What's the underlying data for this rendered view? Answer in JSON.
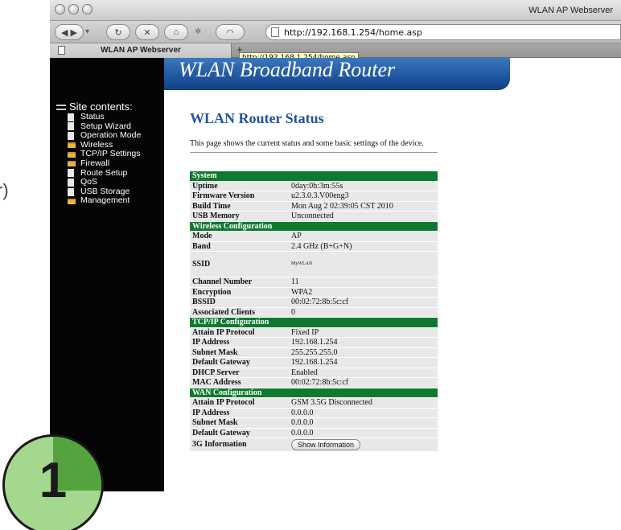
{
  "window": {
    "title": "WLAN AP Webserver"
  },
  "toolbar": {
    "url": "http://192.168.1.254/home.asp"
  },
  "tab": {
    "label": "WLAN AP Webserver",
    "add": "+"
  },
  "tooltip": "http://192.168.1.254/home.asp",
  "banner": {
    "title": "WLAN Broadband Router"
  },
  "sidebar": {
    "heading": "Site contents:",
    "items": [
      {
        "label": "Status",
        "icon": "document-icon"
      },
      {
        "label": "Setup Wizard",
        "icon": "document-icon"
      },
      {
        "label": "Operation Mode",
        "icon": "document-icon"
      },
      {
        "label": "Wireless",
        "icon": "folder-icon"
      },
      {
        "label": "TCP/IP Settings",
        "icon": "folder-icon"
      },
      {
        "label": "Firewall",
        "icon": "folder-icon"
      },
      {
        "label": "Route Setup",
        "icon": "document-icon"
      },
      {
        "label": "QoS",
        "icon": "document-icon"
      },
      {
        "label": "USB Storage",
        "icon": "document-icon"
      },
      {
        "label": "Management",
        "icon": "folder-icon"
      }
    ]
  },
  "main": {
    "title": "WLAN Router Status",
    "description": "This page shows the current status and some basic settings of the device."
  },
  "status": {
    "system": {
      "heading": "System",
      "rows": [
        {
          "k": "Uptime",
          "v": "0day:0h:3m:55s"
        },
        {
          "k": "Firmware Version",
          "v": "u2.3.0.3.V00eng3"
        },
        {
          "k": "Build Time",
          "v": "Mon Aug 2 02:39:05 CST 2010"
        },
        {
          "k": "USB Memory",
          "v": "Unconnected"
        }
      ]
    },
    "wireless": {
      "heading": "Wireless Configuration",
      "rows": [
        {
          "k": "Mode",
          "v": "AP"
        },
        {
          "k": "Band",
          "v": "2.4 GHz (B+G+N)"
        },
        {
          "k": "SSID",
          "v": "MyWLAN"
        },
        {
          "k": "Channel Number",
          "v": "11"
        },
        {
          "k": "Encryption",
          "v": "WPA2"
        },
        {
          "k": "BSSID",
          "v": "00:02:72:8b:5c:cf"
        },
        {
          "k": "Associated Clients",
          "v": "0"
        }
      ]
    },
    "tcpip": {
      "heading": "TCP/IP Configuration",
      "rows": [
        {
          "k": "Attain IP Protocol",
          "v": "Fixed IP"
        },
        {
          "k": "IP Address",
          "v": "192.168.1.254"
        },
        {
          "k": "Subnet Mask",
          "v": "255.255.255.0"
        },
        {
          "k": "Default Gateway",
          "v": "192.168.1.254"
        },
        {
          "k": "DHCP Server",
          "v": "Enabled"
        },
        {
          "k": "MAC Address",
          "v": "00:02:72:8b:5c:cf"
        }
      ]
    },
    "wan": {
      "heading": "WAN Configuration",
      "rows": [
        {
          "k": "Attain IP Protocol",
          "v": "GSM 3.5G Disconnected"
        },
        {
          "k": "IP Address",
          "v": "0.0.0.0"
        },
        {
          "k": "Subnet Mask",
          "v": "0.0.0.0"
        },
        {
          "k": "Default Gateway",
          "v": "0.0.0.0"
        }
      ],
      "info_label": "3G Information",
      "info_button": "Show Information"
    }
  },
  "badge": {
    "number": "1"
  },
  "edge_glyph": "r)"
}
